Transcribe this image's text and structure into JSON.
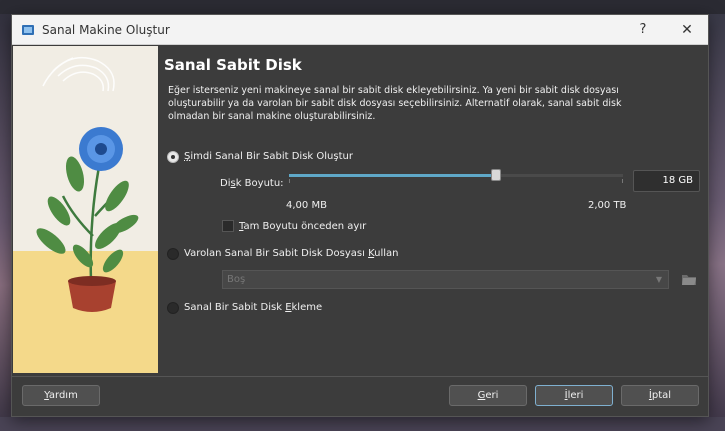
{
  "window": {
    "title": "Sanal Makine Oluştur"
  },
  "titlebar": {
    "help_glyph": "?",
    "close_glyph": "✕"
  },
  "page": {
    "title": "Sanal Sabit Disk",
    "description": "Eğer isterseniz yeni makineye sanal bir sabit disk ekleyebilirsiniz. Ya yeni bir sabit disk dosyası oluşturabilir ya da varolan bir sabit disk dosyası seçebilirsiniz. Alternatif olarak, sanal sabit disk olmadan bir sanal makine oluşturabilirsiniz."
  },
  "options": {
    "create_new": {
      "label_pre": "",
      "label_mn": "Ş",
      "label_post": "imdi Sanal Bir Sabit Disk Oluştur",
      "selected": true
    },
    "use_existing": {
      "label_pre": "Varolan Sanal Bir Sabit Disk Dosyası ",
      "label_mn": "K",
      "label_post": "ullan",
      "selected": false
    },
    "no_disk": {
      "label_pre": "Sanal Bir Sabit Disk ",
      "label_mn": "E",
      "label_post": "kleme",
      "selected": false
    }
  },
  "disk_size": {
    "label_pre": "Di",
    "label_mn": "s",
    "label_post": "k Boyutu:",
    "value": "18 GB",
    "min_label": "4,00 MB",
    "max_label": "2,00 TB",
    "slider_fraction": 0.62
  },
  "preallocate": {
    "label_pre": "",
    "label_mn": "T",
    "label_post": "am Boyutu önceden ayır",
    "checked": false
  },
  "existing_select": {
    "value": "Boş"
  },
  "buttons": {
    "help": {
      "pre": "",
      "mn": "Y",
      "post": "ardım"
    },
    "back": {
      "pre": "",
      "mn": "G",
      "post": "eri"
    },
    "next": {
      "pre": "",
      "mn": "İ",
      "post": "leri"
    },
    "cancel": {
      "pre": "",
      "mn": "İ",
      "post": "ptal"
    }
  },
  "colors": {
    "accent": "#5fa8c8",
    "dialog_bg": "#3c3c3c",
    "titlebar_bg": "#f3f3f3"
  }
}
